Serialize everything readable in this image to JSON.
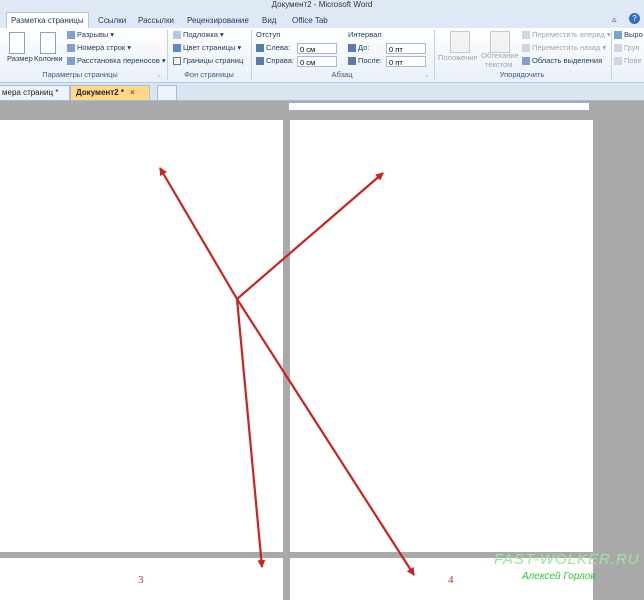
{
  "window": {
    "title": "Документ2 - Microsoft Word"
  },
  "ribbon_tabs": [
    "Разметка страницы",
    "Ссылки",
    "Рассылки",
    "Рецензирование",
    "Вид",
    "Office Tab"
  ],
  "page_setup": {
    "size": "Размер",
    "columns": "Колонки",
    "breaks": "Разрывы",
    "line_numbers": "Номера строк",
    "hyphenation": "Расстановка переносов",
    "label": "Параметры страницы"
  },
  "page_bg": {
    "watermark": "Подложка",
    "page_color": "Цвет страницы",
    "page_borders": "Границы страниц",
    "label": "Фон страницы"
  },
  "paragraph": {
    "indent_title": "Отступ",
    "left": "Слева:",
    "left_val": "0 см",
    "right": "Справа:",
    "right_val": "0 см",
    "spacing_title": "Интервал",
    "before": "До:",
    "before_val": "0 пт",
    "after": "После:",
    "after_val": "0 пт",
    "label": "Абзац"
  },
  "arrange": {
    "position": "Положение",
    "wrap1": "Обтекание",
    "wrap2": "текстом",
    "bring_forward": "Переместить вперед",
    "send_backward": "Переместить назад",
    "selection_pane": "Область выделения",
    "align": "Выро",
    "group": "Груп",
    "rotate": "Пове",
    "label": "Упорядочить"
  },
  "doc_tabs": [
    "мера страниц *",
    "Документ2 *"
  ],
  "pages": {
    "left_number": "3",
    "right_number": "4"
  },
  "watermark": {
    "site": "FAST-WOLKER.RU",
    "author": "Алексей Горлов"
  },
  "colors": {
    "arrow": "#cc2222",
    "page_number": "#c0392b",
    "active_doc_tab": "#ffd98a"
  }
}
